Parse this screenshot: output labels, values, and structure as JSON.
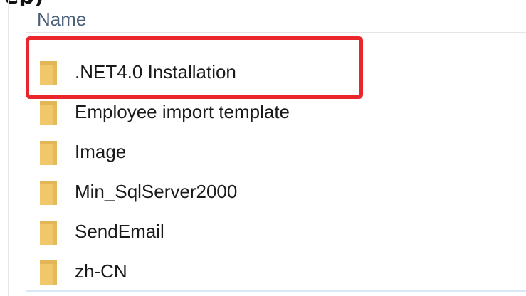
{
  "window": {
    "top_fragment_text": "ep)"
  },
  "header": {
    "name_label": "Name"
  },
  "folders": [
    {
      "name": ".NET4.0 Installation",
      "icon": "folder-icon",
      "highlighted": true
    },
    {
      "name": "Employee import template",
      "icon": "folder-icon",
      "highlighted": false
    },
    {
      "name": "Image",
      "icon": "folder-icon",
      "highlighted": false
    },
    {
      "name": "Min_SqlServer2000",
      "icon": "folder-icon",
      "highlighted": false
    },
    {
      "name": "SendEmail",
      "icon": "folder-icon",
      "highlighted": false
    },
    {
      "name": "zh-CN",
      "icon": "folder-icon",
      "highlighted": false
    }
  ],
  "colors": {
    "highlight": "#e8262b",
    "folder": "#f0c76a",
    "header_text": "#4c607a"
  }
}
